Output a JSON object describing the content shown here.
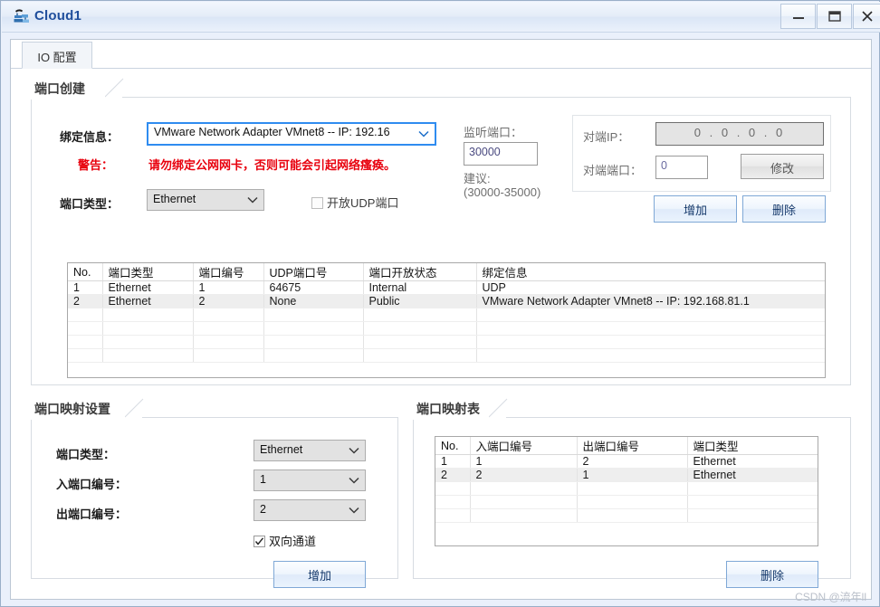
{
  "window": {
    "title": "Cloud1",
    "icon": "cloud-icon",
    "minimize_label": "–",
    "maximize_label": "❑",
    "close_label": "X"
  },
  "tabs": [
    {
      "label": "IO 配置",
      "active": true
    }
  ],
  "port_create": {
    "group_title": "端口创建",
    "binding_label": "绑定信息：",
    "binding_value": "VMware Network Adapter VMnet8 -- IP: 192.16",
    "warning_label": "警告：",
    "warning_text": "请勿绑定公网网卡，否则可能会引起网络瘙痪。",
    "port_type_label": "端口类型：",
    "port_type_value": "Ethernet",
    "udp_checkbox_label": "开放UDP端口",
    "udp_checked": false,
    "listen_port_label": "监听端口：",
    "listen_port_value": "30000",
    "suggest_label": "建议:",
    "suggest_range": "(30000-35000)",
    "peer_ip_label": "对端IP：",
    "peer_ip_value": "0 . 0 . 0 . 0",
    "peer_port_label": "对端端口：",
    "peer_port_value": "0",
    "modify_label": "修改",
    "add_label": "增加",
    "delete_label": "删除"
  },
  "port_table": {
    "columns": [
      "No.",
      "端口类型",
      "端口编号",
      "UDP端口号",
      "端口开放状态",
      "绑定信息"
    ],
    "rows": [
      [
        "1",
        "Ethernet",
        "1",
        "64675",
        "Internal",
        "UDP"
      ],
      [
        "2",
        "Ethernet",
        "2",
        "None",
        "Public",
        "VMware Network Adapter VMnet8 -- IP: 192.168.81.1"
      ]
    ],
    "selected_row_index": 1,
    "empty_row_count": 6
  },
  "mapping_settings": {
    "group_title": "端口映射设置",
    "port_type_label": "端口类型：",
    "port_type_value": "Ethernet",
    "in_port_label": "入端口编号：",
    "in_port_value": "1",
    "out_port_label": "出端口编号：",
    "out_port_value": "2",
    "bidirectional_label": "双向通道",
    "bidirectional_checked": true,
    "add_label": "增加"
  },
  "mapping_table": {
    "group_title": "端口映射表",
    "columns": [
      "No.",
      "入端口编号",
      "出端口编号",
      "端口类型"
    ],
    "rows": [
      [
        "1",
        "1",
        "2",
        "Ethernet"
      ],
      [
        "2",
        "2",
        "1",
        "Ethernet"
      ]
    ],
    "selected_row_index": 1,
    "empty_row_count": 3,
    "delete_label": "删除"
  },
  "watermark": "CSDN @流年ll",
  "colors": {
    "title_text": "#1f4e9c",
    "warning": "#e8000d",
    "window_bg": "#eaf0fb",
    "focus_border": "#2f8cf0",
    "button_blue_text": "#15396b"
  }
}
